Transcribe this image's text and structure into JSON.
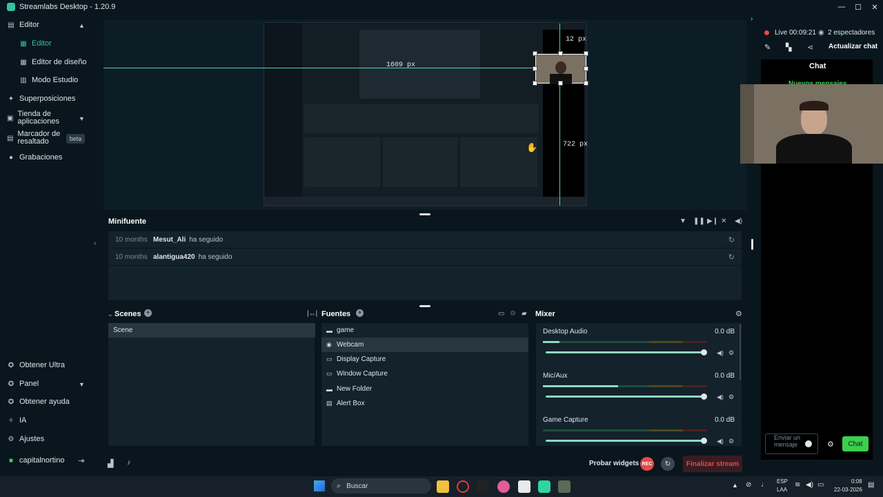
{
  "window": {
    "title": "Streamlabs Desktop - 1.20.9",
    "controls": [
      "—",
      "☐",
      "✕"
    ]
  },
  "sidebar": {
    "items": [
      {
        "label": "Editor",
        "icon": "layout-icon"
      },
      {
        "label": "Editor",
        "icon": "editor-icon"
      },
      {
        "label": "Editor de diseño",
        "icon": "grid-icon"
      },
      {
        "label": "Modo Estudio",
        "icon": "studio-icon"
      },
      {
        "label": "Superposiciones",
        "icon": "overlay-icon"
      },
      {
        "label": "Tienda de aplicaciones",
        "icon": "store-icon"
      },
      {
        "label": "Marcador de resaltado",
        "icon": "highlighter-icon"
      },
      {
        "label": "Grabaciones",
        "icon": "recordings-icon"
      }
    ],
    "beta": "beta",
    "bottom": [
      {
        "label": "Obtener Ultra"
      },
      {
        "label": "Panel"
      },
      {
        "label": "Obtener ayuda"
      },
      {
        "label": "IA"
      },
      {
        "label": "Ajustes"
      }
    ],
    "user": "capitalnortino"
  },
  "preview": {
    "width_readout": "1609 px",
    "height_readout": "722 px",
    "top_readout": "12 px"
  },
  "minifuente": {
    "title": "Minifuente",
    "events": [
      {
        "time": "10 months",
        "user": "Mesut_Ali",
        "action": "ha seguido"
      },
      {
        "time": "10 months",
        "user": "alantigua420",
        "action": "ha seguido"
      }
    ]
  },
  "scenes": {
    "title": "Scenes",
    "items": [
      "Scene"
    ]
  },
  "sources": {
    "title": "Fuentes",
    "items": [
      {
        "label": "game",
        "icon": "folder-icon"
      },
      {
        "label": "Webcam",
        "icon": "webcam-icon"
      },
      {
        "label": "Display Capture",
        "icon": "monitor-icon"
      },
      {
        "label": "Window Capture",
        "icon": "window-icon"
      },
      {
        "label": "New Folder",
        "icon": "folder-icon"
      },
      {
        "label": "Alert Box",
        "icon": "alert-icon"
      }
    ]
  },
  "mixer": {
    "title": "Mixer",
    "channels": [
      {
        "name": "Desktop Audio",
        "db": "0.0 dB",
        "level": 0.1
      },
      {
        "name": "Mic/Aux",
        "db": "0.0 dB",
        "level": 0.46
      },
      {
        "name": "Game Capture",
        "db": "0.0 dB",
        "level": 0.0
      }
    ]
  },
  "footer": {
    "test_widgets": "Probar widgets",
    "rec": "REC",
    "end_stream": "Finalizar stream"
  },
  "right_panel": {
    "live": "Live 00:09:21",
    "viewers": "2 espectadores",
    "refresh_chat": "Actualizar chat",
    "chat_title": "Chat",
    "new_messages": "Nuevos mensajes",
    "input_placeholder": "Enviar un mensaje",
    "chat_button": "Chat"
  },
  "taskbar": {
    "search_placeholder": "Buscar",
    "lang": "ESP",
    "lang2": "LAA",
    "time": "0:08",
    "date": "22-03-2026"
  },
  "colors": {
    "accent": "#31c3a2",
    "end_stream": "#e04b4b",
    "chat_button": "#3ccf4e",
    "live_dot": "#e04b4b"
  }
}
